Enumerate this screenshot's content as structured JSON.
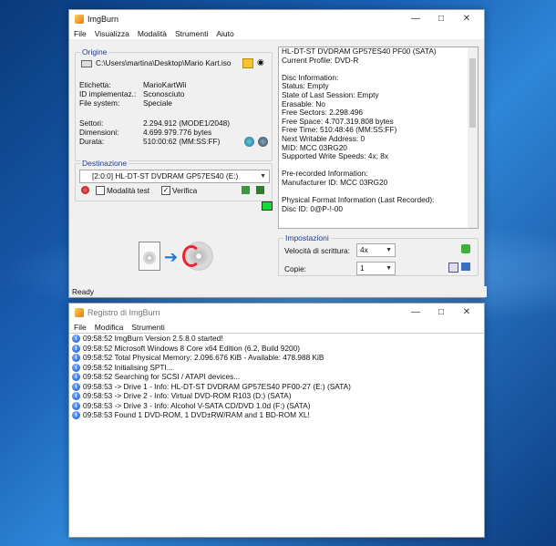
{
  "main": {
    "title": "ImgBurn",
    "menu": [
      "File",
      "Visualizza",
      "Modalità",
      "Strumenti",
      "Aiuto"
    ],
    "source": {
      "legend": "Origine",
      "path": "C:\\Users\\martina\\Desktop\\Mario Kart.iso",
      "fields": [
        {
          "label": "Etichetta:",
          "value": "MarioKartWii"
        },
        {
          "label": "ID implementaz.:",
          "value": "Sconosciuto"
        },
        {
          "label": "File system:",
          "value": "Speciale"
        },
        {
          "label": "Settori:",
          "value": "2.294.912 (MODE1/2048)"
        },
        {
          "label": "Dimensioni:",
          "value": "4.699.979.776 bytes"
        },
        {
          "label": "Durata:",
          "value": "510:00:62 (MM:SS:FF)"
        }
      ]
    },
    "destination": {
      "legend": "Destinazione",
      "drive": "[2:0:0] HL-DT-ST DVDRAM GP57ES40 (E:)",
      "test_mode_label": "Modalità test",
      "test_mode_checked": false,
      "verify_label": "Verifica",
      "verify_checked": true
    },
    "info_lines": [
      "HL-DT-ST DVDRAM GP57ES40 PF00 (SATA)",
      "Current Profile: DVD-R",
      "",
      "Disc Information:",
      "Status: Empty",
      "State of Last Session: Empty",
      "Erasable: No",
      "Free Sectors: 2.298.496",
      "Free Space: 4.707.319.808 bytes",
      "Free Time: 510:48:46 (MM:SS:FF)",
      "Next Writable Address: 0",
      "MID: MCC 03RG20",
      "Supported Write Speeds: 4x; 8x",
      "",
      "Pre-recorded Information:",
      "Manufacturer ID: MCC 03RG20",
      "",
      "Physical Format Information (Last Recorded):",
      "Disc ID: 0@P-!-00"
    ],
    "settings": {
      "legend": "Impostazioni",
      "speed_label": "Velocità di scrittura:",
      "speed_value": "4x",
      "copies_label": "Copie:",
      "copies_value": "1"
    },
    "status": "Ready"
  },
  "log": {
    "title": "Registro di ImgBurn",
    "menu": [
      "File",
      "Modifica",
      "Strumenti"
    ],
    "lines": [
      "09:58:52 ImgBurn Version 2.5.8.0 started!",
      "09:58:52 Microsoft Windows 8 Core x64 Edition (6.2, Build 9200)",
      "09:58:52 Total Physical Memory: 2.096.676 KiB  -  Available: 478.988 KiB",
      "09:58:52 Initialising SPTI...",
      "09:58:52 Searching for SCSI / ATAPI devices...",
      "09:58:53 -> Drive 1 - Info: HL-DT-ST DVDRAM GP57ES40 PF00-27 (E:) (SATA)",
      "09:58:53 -> Drive 2 - Info: Virtual DVD-ROM R103 (D:) (SATA)",
      "09:58:53 -> Drive 3 - Info: Alcohol V-SATA CD/DVD 1.0d (F:) (SATA)",
      "09:58:53 Found 1 DVD-ROM, 1 DVD±RW/RAM and 1 BD-ROM XL!"
    ]
  }
}
